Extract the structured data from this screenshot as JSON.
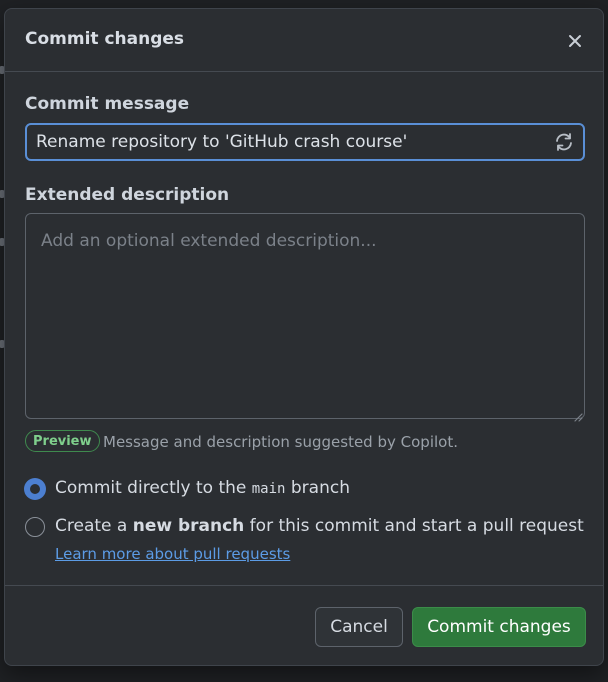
{
  "dialog": {
    "title": "Commit changes",
    "close_icon": "close-icon"
  },
  "commit_message": {
    "label": "Commit message",
    "value": "Rename repository to 'GitHub crash course'",
    "regenerate_icon": "sync-icon"
  },
  "extended_description": {
    "label": "Extended description",
    "placeholder": "Add an optional extended description..."
  },
  "copilot": {
    "badge": "Preview",
    "note": "Message and description suggested by Copilot."
  },
  "branch_options": {
    "direct": {
      "prefix": "Commit directly to the ",
      "branch": "main",
      "suffix": " branch",
      "selected": true
    },
    "new_branch": {
      "prefix": "Create a ",
      "emphasis": "new branch",
      "suffix": " for this commit and start a pull request",
      "selected": false
    },
    "learn_more": "Learn more about pull requests"
  },
  "buttons": {
    "cancel": "Cancel",
    "commit": "Commit changes"
  },
  "colors": {
    "accent": "#4c7fd0",
    "primary_button": "#2e7a3c",
    "preview_badge": "#7fcf8c",
    "link": "#5c9ce6"
  }
}
